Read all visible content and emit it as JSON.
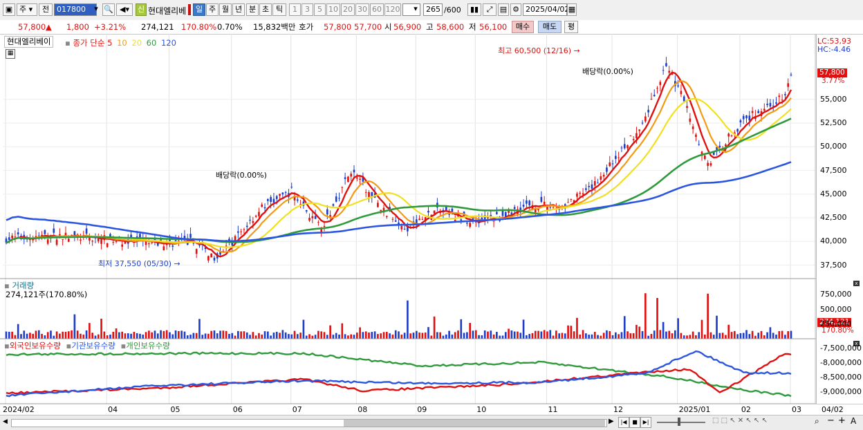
{
  "toolbar": {
    "market_label": "주",
    "prev_label": "전",
    "code": "017800",
    "shin_badge": "신",
    "stock_name": "현대엘리베",
    "periods": [
      "일",
      "주",
      "월",
      "년",
      "분",
      "초",
      "틱"
    ],
    "active_period": "일",
    "intervals": [
      "1",
      "3",
      "5",
      "10",
      "20",
      "30",
      "60",
      "120"
    ],
    "count": "265",
    "count_max": "/600",
    "date": "2025/04/02"
  },
  "quote": {
    "price": "57,800",
    "change": "1,800",
    "change_pct": "+3.21%",
    "volume": "274,121",
    "volume_ratio": "170.80%",
    "turnover": "0.70%",
    "amount": "15,832백만",
    "ask_label": "호가",
    "ask1": "57,800",
    "ask2": "57,700",
    "open_label": "시",
    "open": "56,900",
    "high_label": "고",
    "high": "58,600",
    "low_label": "저",
    "low": "56,100",
    "buy_label": "매수",
    "sell_label": "매도",
    "eval_label": "평"
  },
  "price_panel": {
    "name": "현대엘리베이",
    "ma_title": "종가 단순",
    "ma_periods": [
      {
        "label": "5",
        "color": "#e01010"
      },
      {
        "label": "10",
        "color": "#f29a12"
      },
      {
        "label": "20",
        "color": "#f0e020"
      },
      {
        "label": "60",
        "color": "#2e9a3c"
      },
      {
        "label": "120",
        "color": "#2a55e0"
      }
    ],
    "lc": "LC:53,93",
    "hc": "HC:-4.46",
    "current_price": "57,800",
    "current_pct": "3.77%",
    "high_mark": "최고 60,500 (12/16)",
    "low_mark": "최저 37,550 (05/30)",
    "dividend1": "배당락(0.00%)",
    "dividend2": "배당락(0.00%)",
    "y_ticks": [
      "55,000",
      "52,500",
      "50,000",
      "47,500",
      "45,000",
      "42,500",
      "40,000",
      "37,500"
    ]
  },
  "volume_panel": {
    "title": "거래량",
    "value": "274,121주(170.80%)",
    "y_ticks": [
      "750,000",
      "500,000",
      "250,000"
    ],
    "current": "274,121",
    "current_pct": "170.80%"
  },
  "holdings_panel": {
    "legends": [
      "외국인보유수량",
      "기관보유수량",
      "개인보유수량"
    ],
    "colors": [
      "#e01010",
      "#2a55e0",
      "#2e9a3c"
    ],
    "y_ticks": [
      "-7,500,000",
      "-8,000,000",
      "-8,500,000",
      "-9,000,000"
    ]
  },
  "x_axis": {
    "labels": [
      "2024/02",
      "04",
      "05",
      "06",
      "07",
      "08",
      "09",
      "10",
      "11",
      "12",
      "2025/01",
      "02",
      "03",
      "04"
    ],
    "right_label": "04/02"
  }
}
